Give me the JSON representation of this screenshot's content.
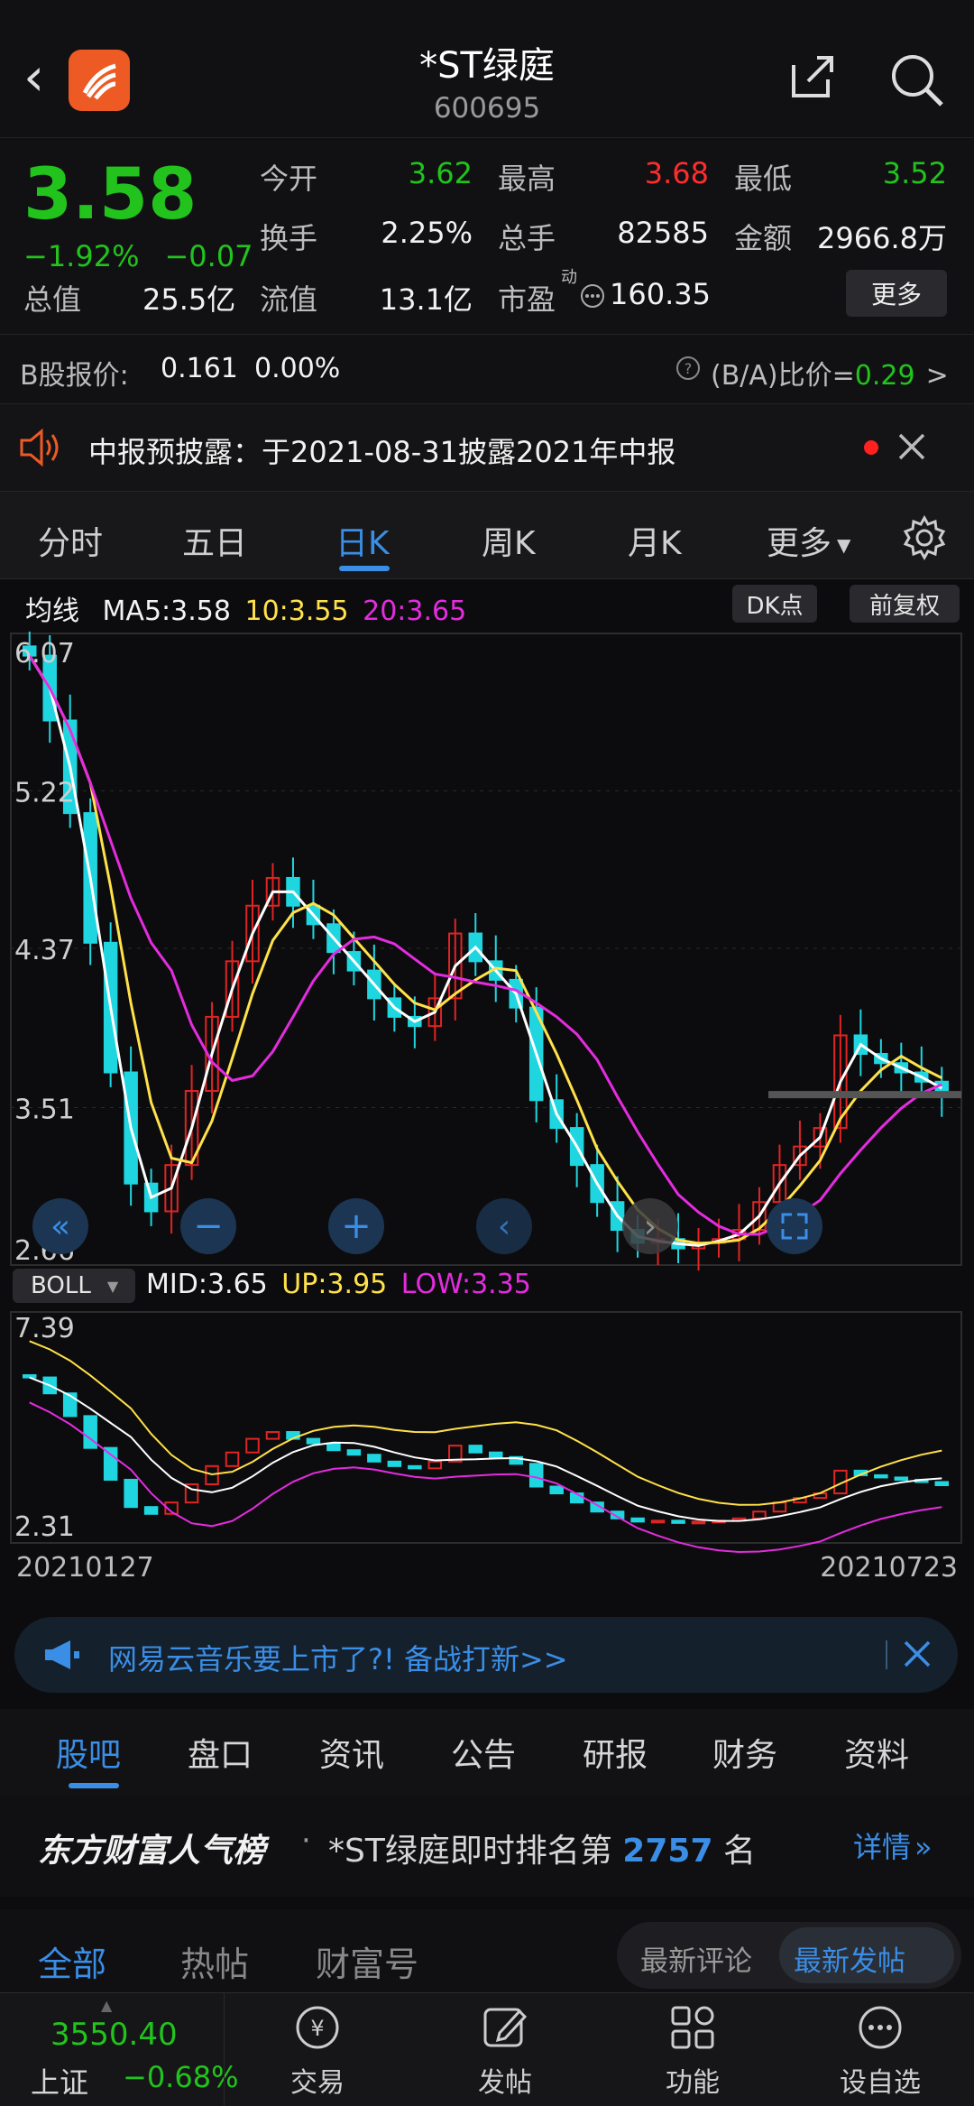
{
  "header": {
    "title": "*ST绿庭",
    "code": "600695"
  },
  "quote": {
    "price": "3.58",
    "change_pct": "−1.92%",
    "change": "−0.07",
    "rows": [
      [
        {
          "label": "今开",
          "value": "3.62",
          "color": "green"
        },
        {
          "label": "最高",
          "value": "3.68",
          "color": "red"
        },
        {
          "label": "最低",
          "value": "3.52",
          "color": "green"
        }
      ],
      [
        {
          "label": "换手",
          "value": "2.25%",
          "color": "white"
        },
        {
          "label": "总手",
          "value": "82585",
          "color": "white"
        },
        {
          "label": "金额",
          "value": "2966.8万",
          "color": "white"
        }
      ],
      [
        {
          "label": "总值",
          "value": "25.5亿",
          "color": "white"
        },
        {
          "label": "流值",
          "value": "13.1亿",
          "color": "white"
        },
        {
          "label": "市盈",
          "value": "160.35",
          "color": "white"
        }
      ]
    ],
    "pe_superscript": "动",
    "more_label": "更多"
  },
  "bshare": {
    "label": "B股报价:",
    "price": "0.161",
    "pct": "0.00%",
    "ratio_label": "(B/A)比价=",
    "ratio_value": "0.29",
    "arrow": ">"
  },
  "notice": {
    "text": "中报预披露：于2021-08-31披露2021年中报"
  },
  "chart_tabs": [
    "分时",
    "五日",
    "日K",
    "周K",
    "月K",
    "更多"
  ],
  "chart_tab_active": 2,
  "ma_legend": {
    "label": "均线",
    "ma5": "MA5:3.58",
    "ma10": "10:3.55",
    "ma20": "20:3.65",
    "dk_button": "DK点",
    "adjust_button": "前复权"
  },
  "boll_legend": {
    "select": "BOLL",
    "mid": "MID:3.65",
    "up": "UP:3.95",
    "low": "LOW:3.35"
  },
  "dates": {
    "start": "20210127",
    "end": "20210723"
  },
  "colors": {
    "up": "#e02424",
    "down": "#1fd6e0",
    "ma5": "#ffffff",
    "ma10": "#ffe14a",
    "ma20": "#e42cdf",
    "accent": "#3a8ee6",
    "green": "#22c31d",
    "red": "#ff2d2d"
  },
  "chart_data": [
    {
      "type": "candlestick",
      "title": "",
      "y_ticks": [
        "6.07",
        "5.22",
        "4.37",
        "3.51",
        "2.66"
      ],
      "ylim": [
        2.66,
        6.07
      ],
      "x_range": [
        "20210127",
        "20210723"
      ],
      "series": [
        {
          "name": "MA5",
          "value": 3.58
        },
        {
          "name": "MA10",
          "value": 3.55
        },
        {
          "name": "MA20",
          "value": 3.65
        }
      ],
      "closes": [
        5.95,
        5.6,
        5.1,
        4.4,
        3.7,
        3.1,
        2.95,
        3.2,
        3.6,
        4.0,
        4.3,
        4.6,
        4.75,
        4.6,
        4.5,
        4.35,
        4.25,
        4.1,
        4.0,
        3.95,
        4.1,
        4.45,
        4.3,
        4.2,
        4.05,
        3.55,
        3.4,
        3.2,
        3.0,
        2.85,
        2.78,
        2.8,
        2.75,
        2.78,
        2.8,
        2.85,
        3.0,
        3.2,
        3.3,
        3.4,
        3.9,
        3.8,
        3.75,
        3.7,
        3.65,
        3.58
      ]
    },
    {
      "type": "line",
      "title": "",
      "y_ticks": [
        "7.39",
        "2.31"
      ],
      "ylim": [
        2.31,
        7.39
      ],
      "series": [
        {
          "name": "MID",
          "value": 3.65
        },
        {
          "name": "UP",
          "value": 3.95
        },
        {
          "name": "LOW",
          "value": 3.35
        }
      ]
    }
  ],
  "ad": {
    "text": "网易云音乐要上市了?! 备战打新>>"
  },
  "bottom_tabs": [
    "股吧",
    "盘口",
    "资讯",
    "公告",
    "研报",
    "财务",
    "资料"
  ],
  "bottom_tab_active": 0,
  "rank": {
    "brand": "东方财富人气榜",
    "prefix": "*ST绿庭即时排名第",
    "number": "2757",
    "suffix": "名",
    "detail": "详情"
  },
  "sub_tabs": [
    "全部",
    "热帖",
    "财富号"
  ],
  "sort_buttons": [
    "最新评论",
    "最新发帖"
  ],
  "footer": {
    "index_value": "3550.40",
    "index_name": "上证",
    "index_change": "−0.68%",
    "buttons": [
      "交易",
      "发帖",
      "功能",
      "设自选"
    ]
  }
}
